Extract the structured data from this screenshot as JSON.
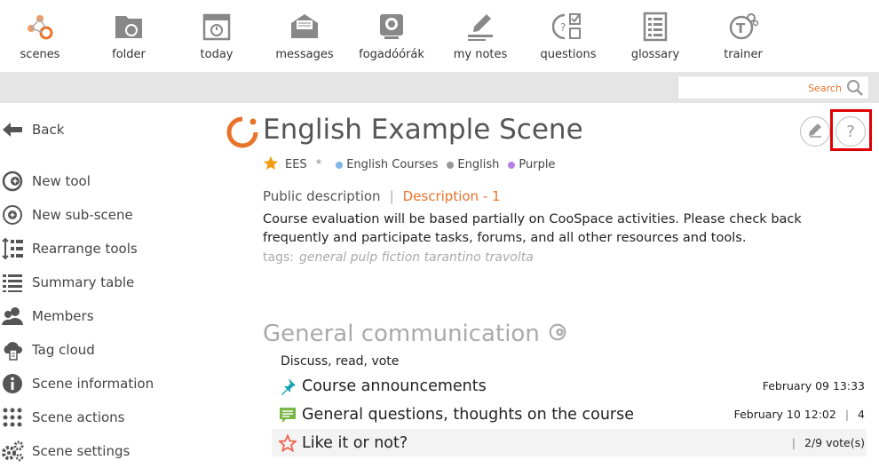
{
  "toolbar": {
    "items": [
      {
        "label": "scenes",
        "icon": "scenes-icon"
      },
      {
        "label": "folder",
        "icon": "folder-icon"
      },
      {
        "label": "today",
        "icon": "calendar-icon"
      },
      {
        "label": "messages",
        "icon": "envelope-icon"
      },
      {
        "label": "fogadóórák",
        "icon": "webcam-icon"
      },
      {
        "label": "my notes",
        "icon": "pencil-icon"
      },
      {
        "label": "questions",
        "icon": "questions-icon"
      },
      {
        "label": "glossary",
        "icon": "glossary-icon"
      },
      {
        "label": "trainer",
        "icon": "trainer-icon"
      }
    ]
  },
  "search": {
    "placeholder": "Search"
  },
  "sidebar": {
    "items": [
      {
        "label": "Back",
        "icon": "arrow-left-icon"
      },
      {
        "label": "New tool",
        "icon": "add-tool-icon"
      },
      {
        "label": "New sub-scene",
        "icon": "add-circle-icon"
      },
      {
        "label": "Rearrange tools",
        "icon": "rearrange-icon"
      },
      {
        "label": "Summary table",
        "icon": "list-icon"
      },
      {
        "label": "Members",
        "icon": "members-icon"
      },
      {
        "label": "Tag cloud",
        "icon": "tag-cloud-icon"
      },
      {
        "label": "Scene information",
        "icon": "info-icon"
      },
      {
        "label": "Scene actions",
        "icon": "grid-dots-icon"
      },
      {
        "label": "Scene settings",
        "icon": "gears-icon"
      }
    ]
  },
  "scene": {
    "title": "English Example Scene",
    "short_name": "EES",
    "asterisk": "*",
    "tags_meta": [
      {
        "label": "English Courses",
        "color": "#7fb6e6"
      },
      {
        "label": "English",
        "color": "#999999"
      },
      {
        "label": "Purple",
        "color": "#b77fe6"
      }
    ],
    "tab_public": "Public description",
    "tab_separator": "|",
    "tab_description": "Description - 1",
    "description": "Course evaluation will be based partially on CooSpace activities. Please check back frequently and participate tasks, forums, and all other resources and tools.",
    "tags_label": "tags:",
    "tags": "general pulp fiction tarantino travolta"
  },
  "section": {
    "title": "General communication",
    "subtitle": "Discuss, read, vote",
    "rows": [
      {
        "title": "Course announcements",
        "date": "February 09 13:33",
        "count": "",
        "icon": "pin-icon"
      },
      {
        "title": "General questions, thoughts on the course",
        "date": "February 10 12:02",
        "count": "4",
        "icon": "forum-icon"
      },
      {
        "title": "Like it or not?",
        "date": "",
        "count": "2/9 vote(s)",
        "icon": "vote-star-icon"
      }
    ]
  },
  "colors": {
    "accent": "#e8732a",
    "highlight": "#e00000"
  }
}
